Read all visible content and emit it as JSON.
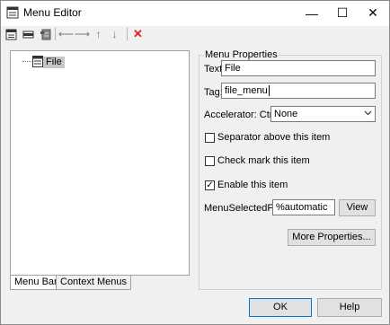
{
  "window": {
    "title": "Menu Editor",
    "controls": {
      "minimize": "—",
      "maximize": "☐",
      "close": "✕"
    }
  },
  "toolbar": {
    "items": [
      "new-menu-icon",
      "new-menu-item-icon",
      "new-context-menu-icon",
      "move-left-icon",
      "move-right-icon",
      "move-up-icon",
      "move-down-icon",
      "delete-icon"
    ],
    "glyphs": {
      "left": "⟵",
      "right": "⟶",
      "up": "↑",
      "down": "↓",
      "delete": "✕"
    },
    "delete_color": "#e02020"
  },
  "tree": {
    "nodes": [
      {
        "label": "File",
        "selected": true
      }
    ]
  },
  "tabs": [
    {
      "label": "Menu Bar",
      "active": true
    },
    {
      "label": "Context Menus",
      "active": false
    }
  ],
  "properties": {
    "group_title": "Menu Properties",
    "text_label": "Text:",
    "text_value": "File",
    "tag_label": "Tag:",
    "tag_value": "file_menu",
    "accelerator_label": "Accelerator: Ctrl +",
    "accelerator_value": "None",
    "separator_label": "Separator above this item",
    "separator_checked": false,
    "checkmark_label": "Check mark this item",
    "checkmark_checked": false,
    "enable_label": "Enable this item",
    "enable_checked": true,
    "check_glyph": "✓",
    "callback_label": "MenuSelectedFcn:",
    "callback_value": "%automatic",
    "view_label": "View",
    "more_label": "More Properties..."
  },
  "footer": {
    "ok_label": "OK",
    "help_label": "Help"
  }
}
